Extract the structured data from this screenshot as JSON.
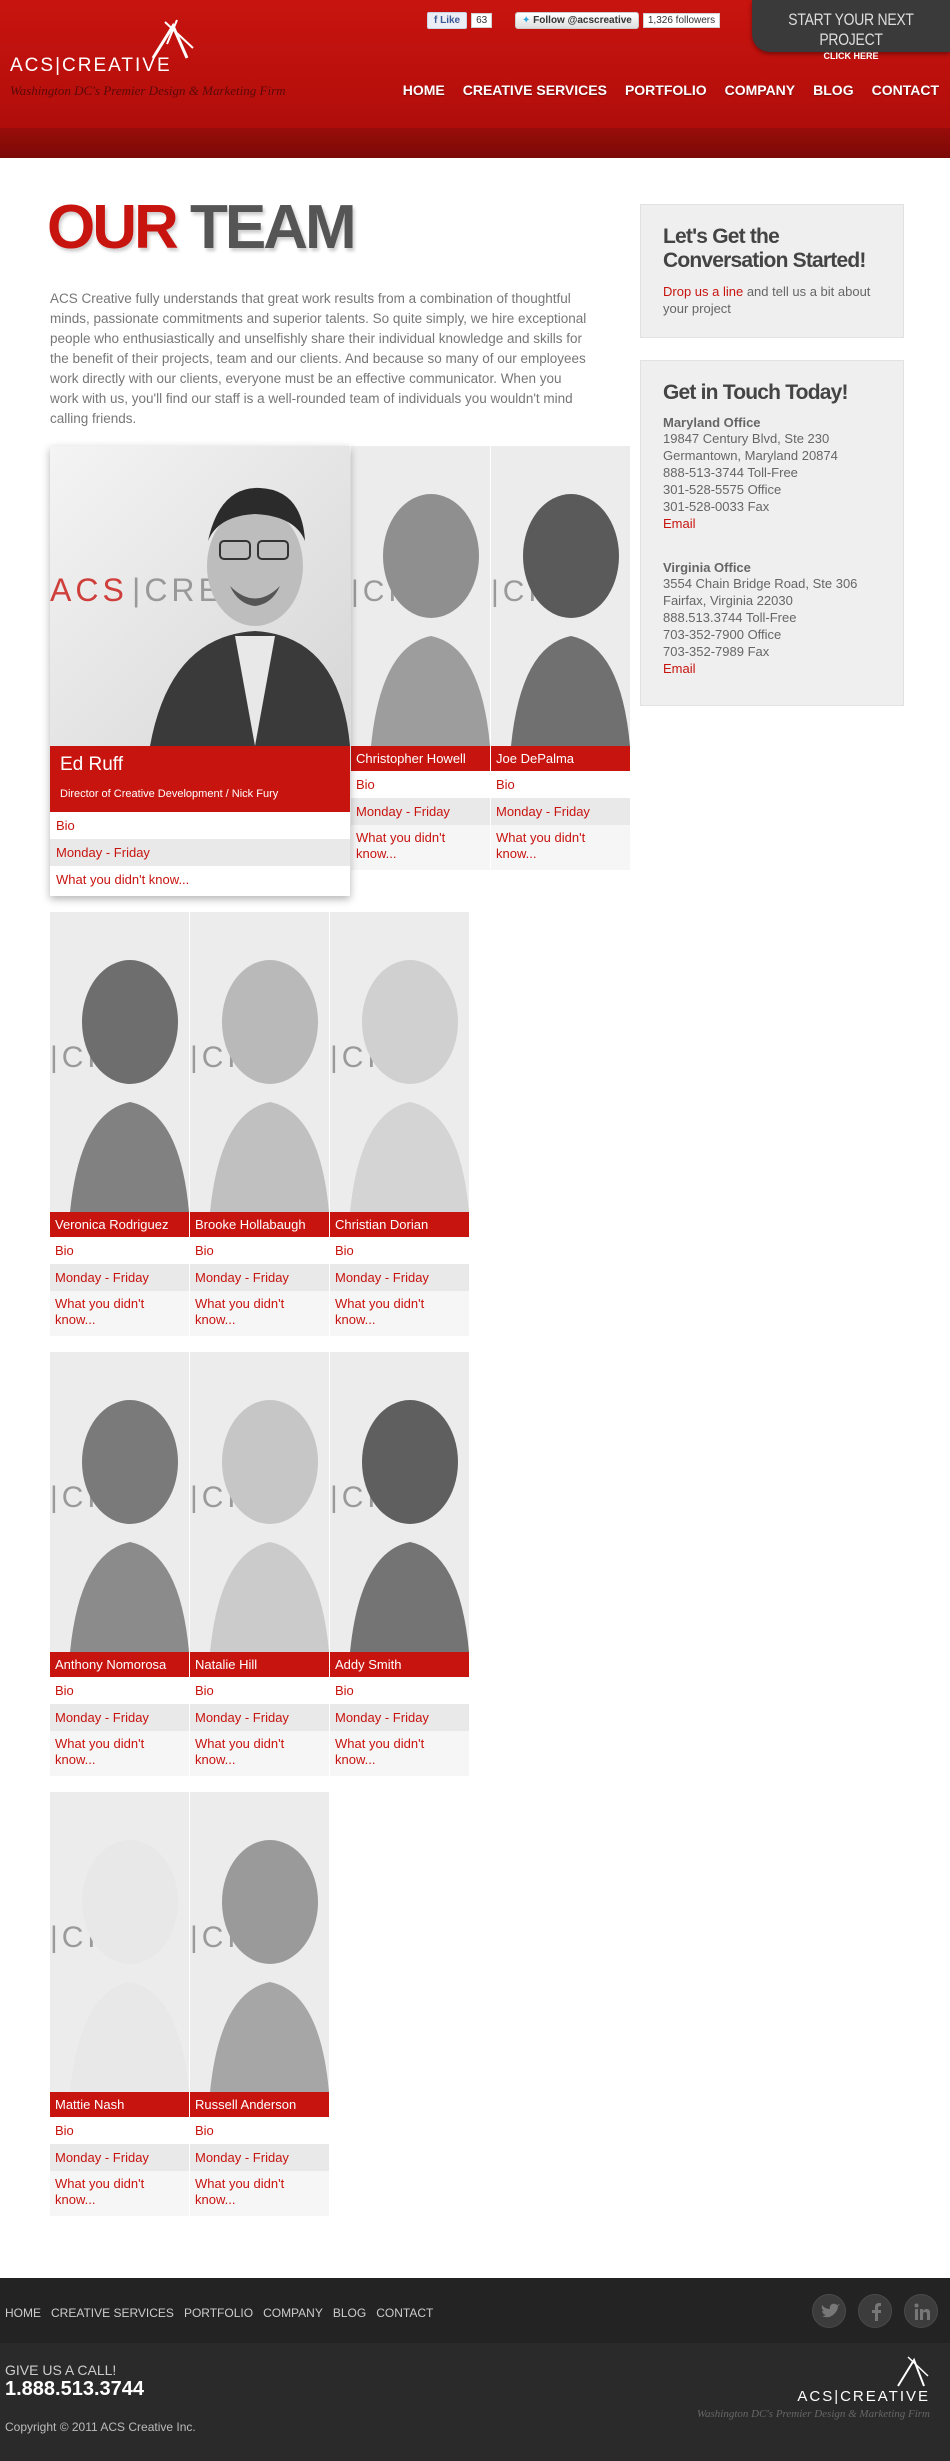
{
  "header": {
    "logo_text": "ACS|CREATIVE",
    "tagline": "Washington DC's Premier Design & Marketing Firm",
    "facebook": {
      "label": "Like",
      "count": "63"
    },
    "twitter": {
      "label": "Follow @acscreative",
      "count": "1,326 followers"
    },
    "cta": {
      "main": "START YOUR NEXT PROJECT",
      "sub": "CLICK HERE"
    },
    "nav": [
      "HOME",
      "CREATIVE SERVICES",
      "PORTFOLIO",
      "COMPANY",
      "BLOG",
      "CONTACT"
    ]
  },
  "main": {
    "title_red": "OUR",
    "title_gray": "TEAM",
    "intro": "ACS Creative fully understands that great work results from a combination of thoughtful minds, passionate commitments and superior talents. So quite simply, we hire exceptional people who enthusiastically and unselfishly share their individual knowledge and skills for the benefit of their projects, team and our clients. And because so many of our employees work directly with our clients, everyone must be an effective communicator. When you work with us, you'll find our staff is a well-rounded team of individuals you wouldn't mind calling friends."
  },
  "featured": {
    "name": "Ed Ruff",
    "title": "Director of Creative Development / Nick Fury",
    "bio": "Bio",
    "hours": "Monday - Friday",
    "didnt_know": "What you didn't know..."
  },
  "team": [
    {
      "name": "Christopher Howell",
      "bio": "Bio",
      "hours": "Monday - Friday",
      "didnt_know": "What you didn't know..."
    },
    {
      "name": "Joe DePalma",
      "bio": "Bio",
      "hours": "Monday - Friday",
      "didnt_know": "What you didn't know..."
    },
    {
      "name": "Veronica Rodriguez",
      "bio": "Bio",
      "hours": "Monday - Friday",
      "didnt_know": "What you didn't know..."
    },
    {
      "name": "Brooke Hollabaugh",
      "bio": "Bio",
      "hours": "Monday - Friday",
      "didnt_know": "What you didn't know..."
    },
    {
      "name": "Christian Dorian",
      "bio": "Bio",
      "hours": "Monday - Friday",
      "didnt_know": "What you didn't know..."
    },
    {
      "name": "Anthony Nomorosa",
      "bio": "Bio",
      "hours": "Monday - Friday",
      "didnt_know": "What you didn't know..."
    },
    {
      "name": "Natalie Hill",
      "bio": "Bio",
      "hours": "Monday - Friday",
      "didnt_know": "What you didn't know..."
    },
    {
      "name": "Addy Smith",
      "bio": "Bio",
      "hours": "Monday - Friday",
      "didnt_know": "What you didn't know..."
    },
    {
      "name": "Mattie Nash",
      "bio": "Bio",
      "hours": "Monday - Friday",
      "didnt_know": "What you didn't know..."
    },
    {
      "name": "Russell Anderson",
      "bio": "Bio",
      "hours": "Monday - Friday",
      "didnt_know": "What you didn't know..."
    }
  ],
  "photo_watermark": "ACS|CREATIVE",
  "sidebar": {
    "convo": {
      "heading": "Let's Get the Conversation Started!",
      "link_text": "Drop us a line",
      "rest_text": " and tell us a bit about your project"
    },
    "touch": {
      "heading": "Get in Touch Today!",
      "maryland": {
        "name": "Maryland Office",
        "lines": [
          "19847 Century Blvd, Ste 230",
          "Germantown, Maryland 20874",
          "888-513-3744 Toll-Free",
          "301-528-5575 Office",
          "301-528-0033 Fax"
        ],
        "email": "Email"
      },
      "virginia": {
        "name": "Virginia Office",
        "lines": [
          "3554 Chain Bridge Road, Ste 306",
          "Fairfax, Virginia 22030",
          "888.513.3744 Toll-Free",
          "703-352-7900 Office",
          "703-352-7989 Fax"
        ],
        "email": "Email"
      }
    }
  },
  "footer": {
    "nav": [
      "HOME",
      "CREATIVE SERVICES",
      "PORTFOLIO",
      "COMPANY",
      "BLOG",
      "CONTACT"
    ],
    "call_label": "GIVE US A CALL!",
    "phone": "1.888.513.3744",
    "copyright": "Copyright © 2011 ACS Creative Inc.",
    "logo_text": "ACS|CREATIVE",
    "tagline": "Washington DC's Premier Design & Marketing Firm",
    "social": [
      "twitter-icon",
      "facebook-icon",
      "linkedin-icon"
    ]
  },
  "colors": {
    "brand_red": "#c8140f",
    "dark": "#2a2a2a",
    "sidebar_bg": "#efefef"
  }
}
